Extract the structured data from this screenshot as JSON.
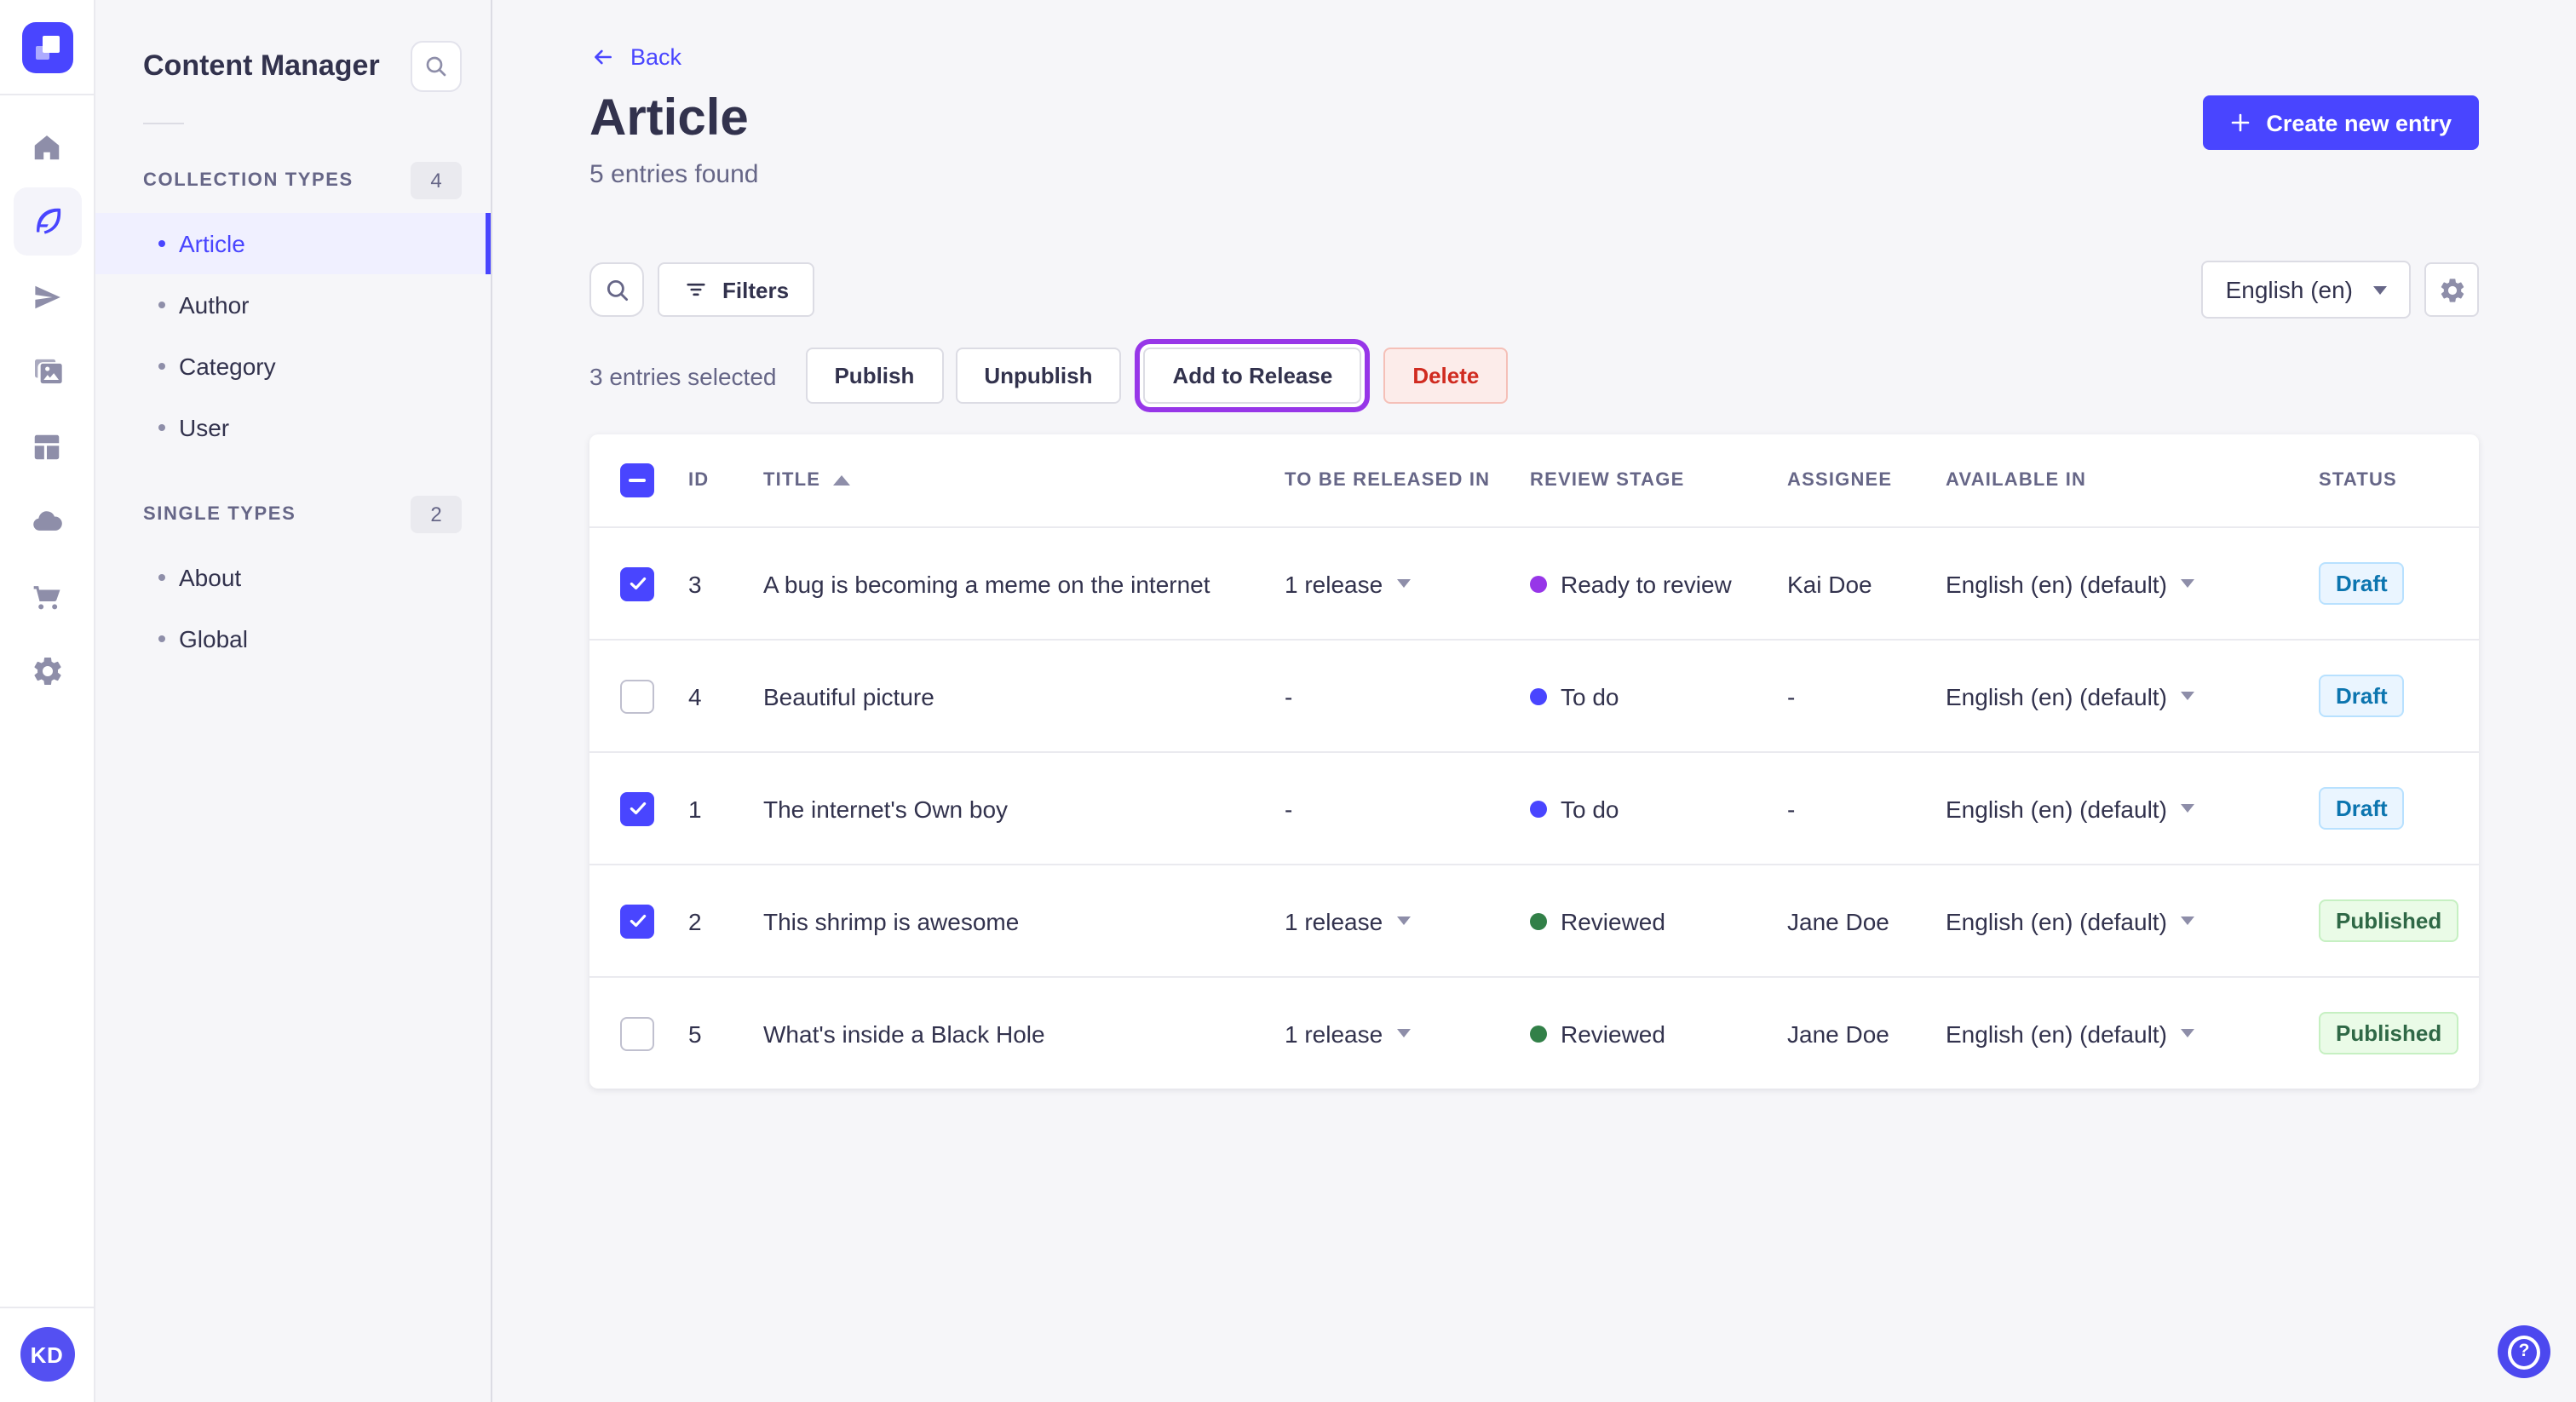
{
  "brand": {
    "primary_color": "#4945ff",
    "release_focus_color": "#9736e8"
  },
  "icon_sidebar": {
    "logo": "strapi-logo",
    "items": [
      {
        "name": "home"
      },
      {
        "name": "content-manager",
        "active": true
      },
      {
        "name": "releases"
      },
      {
        "name": "media-library"
      },
      {
        "name": "content-type-builder"
      },
      {
        "name": "cloud"
      },
      {
        "name": "marketplace"
      },
      {
        "name": "settings"
      }
    ],
    "avatar_initials": "KD"
  },
  "subnav": {
    "title": "Content Manager",
    "sections": [
      {
        "label": "COLLECTION TYPES",
        "count": "4",
        "items": [
          {
            "label": "Article",
            "active": true
          },
          {
            "label": "Author"
          },
          {
            "label": "Category"
          },
          {
            "label": "User"
          }
        ]
      },
      {
        "label": "SINGLE TYPES",
        "count": "2",
        "items": [
          {
            "label": "About"
          },
          {
            "label": "Global"
          }
        ]
      }
    ]
  },
  "header": {
    "back_label": "Back",
    "title": "Article",
    "subtitle": "5 entries found",
    "create_button_label": "Create new entry"
  },
  "toolbar": {
    "filters_label": "Filters",
    "locale_selected": "English (en)"
  },
  "selection_bar": {
    "selected_text": "3 entries selected",
    "publish_label": "Publish",
    "unpublish_label": "Unpublish",
    "add_to_release_label": "Add to Release",
    "delete_label": "Delete"
  },
  "table": {
    "columns": {
      "id": "ID",
      "title": "TITLE",
      "release": "TO BE RELEASED IN",
      "stage": "REVIEW STAGE",
      "assignee": "ASSIGNEE",
      "available": "AVAILABLE IN",
      "status": "STATUS"
    },
    "sort": {
      "column": "TITLE",
      "direction": "asc"
    },
    "stage_colors": {
      "to_do": "#4945ff",
      "ready_to_review": "#9736e8",
      "reviewed": "#328048"
    },
    "status_colors": {
      "draft_text": "#0c75af",
      "draft_bg": "#eaf5ff",
      "published_text": "#2f6846",
      "published_bg": "#eafbe7"
    },
    "rows": [
      {
        "selected": true,
        "id": "3",
        "title": "A bug is becoming a meme on the internet",
        "release": "1 release",
        "stage": "Ready to review",
        "stage_color": "#9736e8",
        "assignee": "Kai Doe",
        "available": "English (en) (default)",
        "status": "Draft"
      },
      {
        "selected": false,
        "id": "4",
        "title": "Beautiful picture",
        "release": "-",
        "stage": "To do",
        "stage_color": "#4945ff",
        "assignee": "-",
        "available": "English (en) (default)",
        "status": "Draft"
      },
      {
        "selected": true,
        "id": "1",
        "title": "The internet's Own boy",
        "release": "-",
        "stage": "To do",
        "stage_color": "#4945ff",
        "assignee": "-",
        "available": "English (en) (default)",
        "status": "Draft"
      },
      {
        "selected": true,
        "id": "2",
        "title": "This shrimp is awesome",
        "release": "1 release",
        "stage": "Reviewed",
        "stage_color": "#328048",
        "assignee": "Jane Doe",
        "available": "English (en) (default)",
        "status": "Published"
      },
      {
        "selected": false,
        "id": "5",
        "title": "What's inside a Black Hole",
        "release": "1 release",
        "stage": "Reviewed",
        "stage_color": "#328048",
        "assignee": "Jane Doe",
        "available": "English (en) (default)",
        "status": "Published"
      }
    ]
  },
  "help": {
    "label": "help"
  }
}
